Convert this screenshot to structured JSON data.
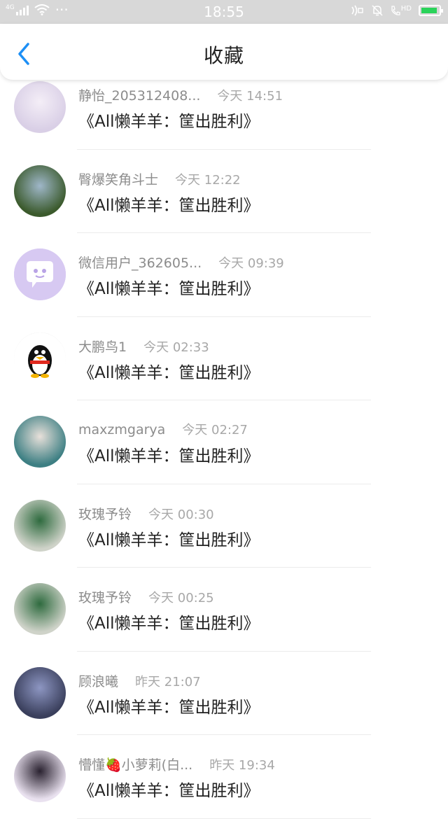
{
  "status_bar": {
    "network": "4G",
    "dots": "···",
    "time": "18:55",
    "hd": "HD"
  },
  "header": {
    "title": "收藏"
  },
  "items": [
    {
      "name": "静怡_205312408...",
      "time": "今天 14:51",
      "message": "《All懒羊羊：筐出胜利》",
      "avatar_color": "#d9cfe6",
      "avatar_accent": "#f4eef7"
    },
    {
      "name": "臀爆笑角斗士",
      "time": "今天 12:22",
      "message": "《All懒羊羊：筐出胜利》",
      "avatar_color": "#3b5a2c",
      "avatar_accent": "#9fb7c9"
    },
    {
      "name": "微信用户_362605...",
      "time": "今天 09:39",
      "message": "《All懒羊羊：筐出胜利》",
      "avatar_color": "#d7c9f2",
      "avatar_accent": "#ffffff"
    },
    {
      "name": "大鹏鸟1",
      "time": "今天 02:33",
      "message": "《All懒羊羊：筐出胜利》",
      "avatar_color": "#ffffff",
      "avatar_accent": "#111111"
    },
    {
      "name": "maxzmgarya",
      "time": "今天 02:27",
      "message": "《All懒羊羊：筐出胜利》",
      "avatar_color": "#3d7f83",
      "avatar_accent": "#e8e0da"
    },
    {
      "name": "玫瑰予铃",
      "time": "今天 00:30",
      "message": "《All懒羊羊：筐出胜利》",
      "avatar_color": "#cfd3c9",
      "avatar_accent": "#2f6b3f"
    },
    {
      "name": "玫瑰予铃",
      "time": "今天 00:25",
      "message": "《All懒羊羊：筐出胜利》",
      "avatar_color": "#cfd3c9",
      "avatar_accent": "#2f6b3f"
    },
    {
      "name": "顾浪曦",
      "time": "昨天 21:07",
      "message": "《All懒羊羊：筐出胜利》",
      "avatar_color": "#3a3f5c",
      "avatar_accent": "#8d96c2"
    },
    {
      "name": "懵懂🍓小萝莉(白...",
      "time": "昨天 19:34",
      "message": "《All懒羊羊：筐出胜利》",
      "avatar_color": "#e9e1ef",
      "avatar_accent": "#2a2230"
    }
  ],
  "colors": {
    "accent": "#1d8ff5",
    "status_bar_bg": "#d8d8d8",
    "battery": "#2ad35a"
  }
}
